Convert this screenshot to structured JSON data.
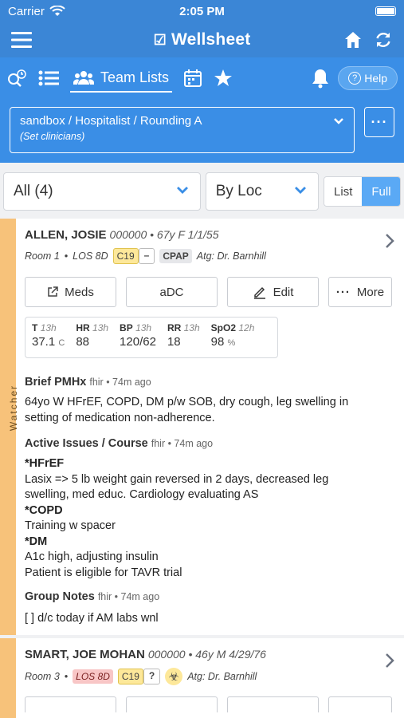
{
  "status": {
    "carrier": "Carrier",
    "time": "2:05 PM"
  },
  "app": {
    "brand": "Wellsheet"
  },
  "toolbar": {
    "team_lists_label": "Team Lists",
    "help_label": "Help"
  },
  "list_selector": {
    "path": "sandbox / Hospitalist / Rounding A",
    "subtitle": "(Set clinicians)",
    "more": "···"
  },
  "filters": {
    "group": "All (4)",
    "sort": "By Loc",
    "view_list": "List",
    "view_full": "Full"
  },
  "patients": [
    {
      "watcher": "Watcher",
      "name": "ALLEN, JOSIE",
      "meta": "000000 • 67y F 1/1/55",
      "room": "Room 1",
      "los": "LOS 8D",
      "c19": "C19",
      "c19_status": "–",
      "cpap": "CPAP",
      "attending": "Atg: Dr. Barnhill",
      "buttons": {
        "meds": "Meds",
        "adc": "aDC",
        "edit": "Edit",
        "more": "More"
      },
      "vitals": [
        {
          "label": "T",
          "age": "13h",
          "value": "37.1",
          "unit": "C"
        },
        {
          "label": "HR",
          "age": "13h",
          "value": "88",
          "unit": ""
        },
        {
          "label": "BP",
          "age": "13h",
          "value": "120/62",
          "unit": ""
        },
        {
          "label": "RR",
          "age": "13h",
          "value": "18",
          "unit": ""
        },
        {
          "label": "SpO2",
          "age": "12h",
          "value": "98",
          "unit": "%"
        }
      ],
      "brief_title": "Brief PMHx",
      "brief_meta": "fhir • 74m ago",
      "brief_text_1": "64yo W HFrEF, COPD, DM p/w SOB, dry cough, leg swelling in",
      "brief_text_2": "setting of medication non-adherence.",
      "issues_title": "Active Issues / Course",
      "issues_meta": "fhir • 74m ago",
      "issues": {
        "h1": "*HFrEF",
        "l1": "Lasix => 5 lb weight gain reversed in 2 days, decreased leg",
        "l2": "swelling, med educ. Cardiology evaluating AS",
        "h2": "*COPD",
        "l3": "Training w spacer",
        "h3": "*DM",
        "l4": "A1c high, adjusting insulin",
        "l5": "Patient is eligible for TAVR trial"
      },
      "notes_title": "Group Notes",
      "notes_meta": "fhir • 74m ago",
      "notes_text": "[ ] d/c today if AM labs wnl"
    },
    {
      "name": "SMART, JOE MOHAN",
      "meta": "000000 • 46y M 4/29/76",
      "room": "Room 3",
      "los": "LOS 8D",
      "c19": "C19",
      "c19_status": "?",
      "attending": "Atg: Dr. Barnhill"
    }
  ],
  "colors": {
    "header": "#3b86d6",
    "toolbar": "#3a8ee6",
    "watcher": "#f7c27a",
    "accent": "#5aa9f5"
  }
}
